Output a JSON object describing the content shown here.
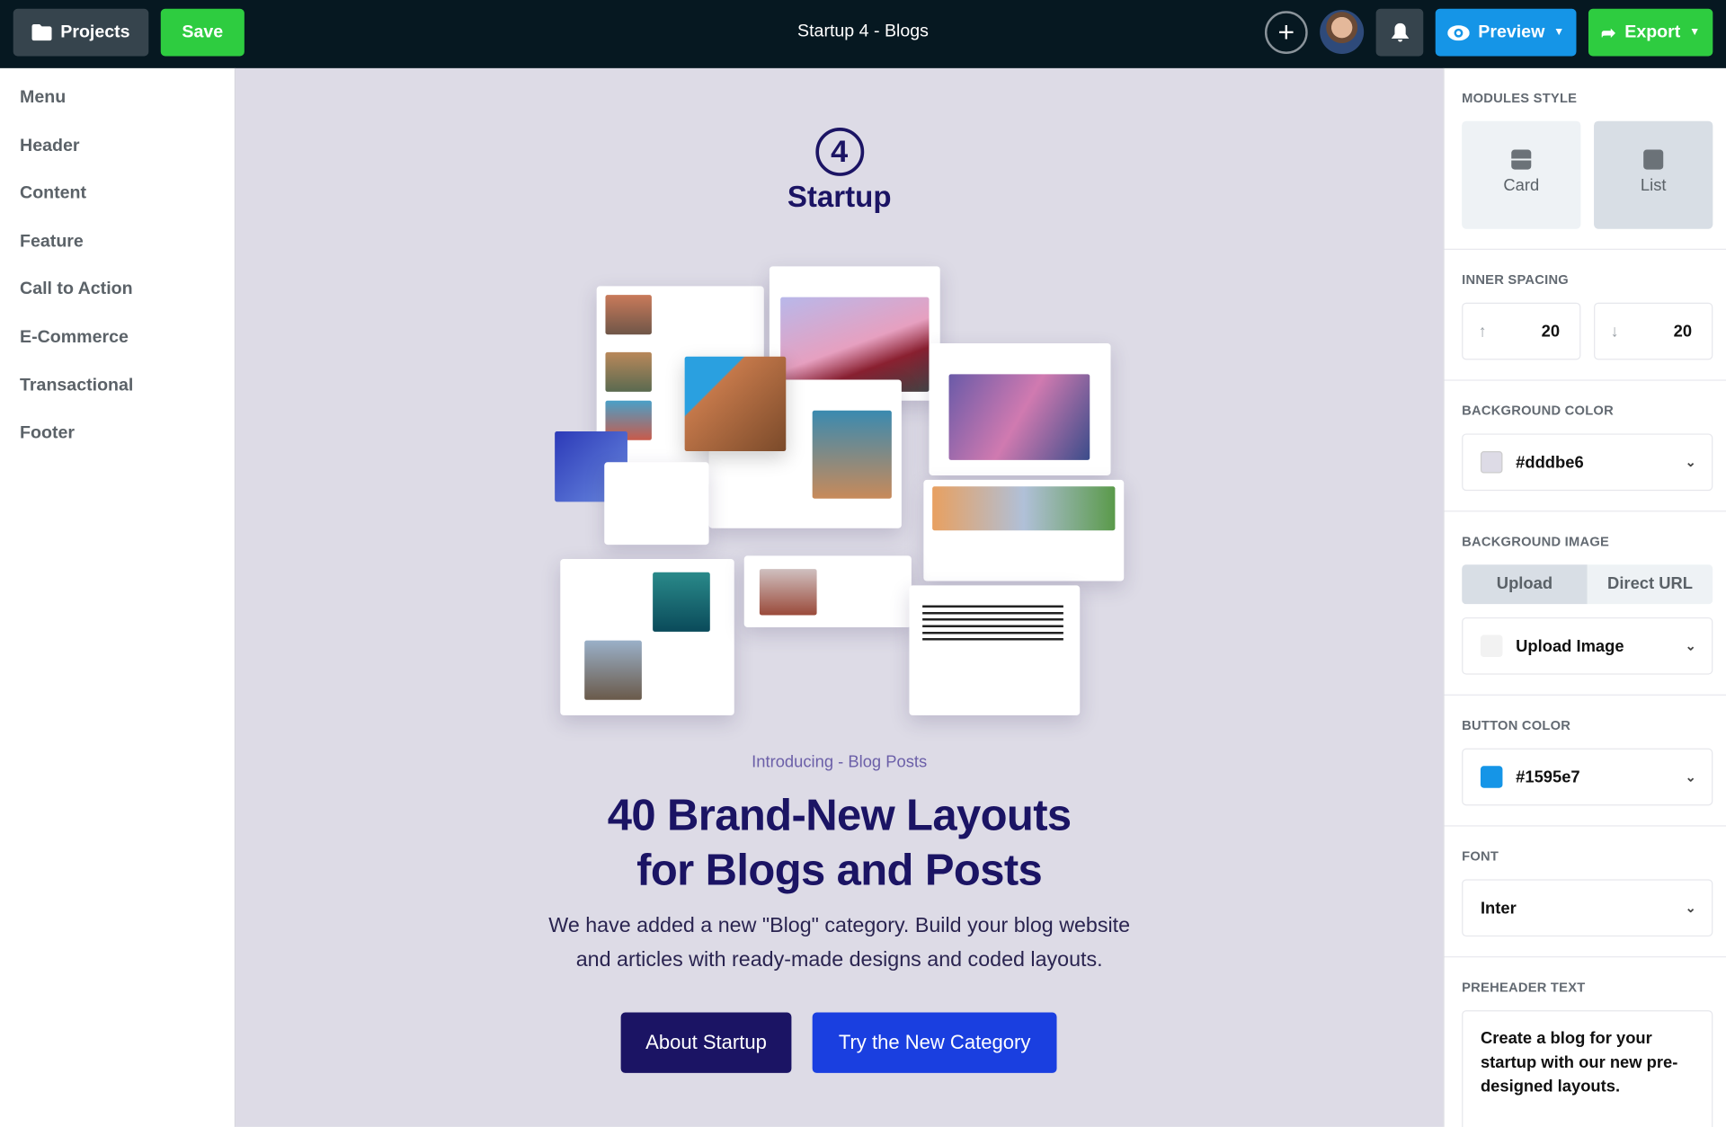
{
  "topbar": {
    "projects_label": "Projects",
    "save_label": "Save",
    "title": "Startup 4 - Blogs",
    "preview_label": "Preview",
    "export_label": "Export",
    "icons": {
      "projects": "folder-icon",
      "add": "plus-circle-icon",
      "notifications": "bell-icon",
      "preview": "eye-icon",
      "export": "share-arrow-icon"
    }
  },
  "sidebar": {
    "items": [
      {
        "label": "Menu"
      },
      {
        "label": "Header"
      },
      {
        "label": "Content"
      },
      {
        "label": "Feature"
      },
      {
        "label": "Call to Action"
      },
      {
        "label": "E-Commerce"
      },
      {
        "label": "Transactional"
      },
      {
        "label": "Footer"
      }
    ]
  },
  "canvas": {
    "background": "#dddbe6",
    "logo_number": "4",
    "logo_text": "Startup",
    "eyebrow": "Introducing - Blog Posts",
    "headline_line1": "40 Brand-New Layouts",
    "headline_line2": "for Blogs and Posts",
    "body_line1": "We have added a new \"Blog\" category. Build your blog website",
    "body_line2": "and articles with ready-made designs and coded layouts.",
    "primary_button": "About Startup",
    "secondary_button": "Try the New Category",
    "colors": {
      "dark": "#1b1464",
      "blue": "#1a3fe0"
    }
  },
  "panel": {
    "modules_style": {
      "label": "MODULES STYLE",
      "options": [
        {
          "label": "Card",
          "icon": "card-layout-icon"
        },
        {
          "label": "List",
          "icon": "list-layout-icon"
        }
      ],
      "selected": "List"
    },
    "inner_spacing": {
      "label": "INNER SPACING",
      "top": "20",
      "bottom": "20"
    },
    "background_color": {
      "label": "BACKGROUND COLOR",
      "value": "#dddbe6"
    },
    "background_image": {
      "label": "BACKGROUND IMAGE",
      "tabs": [
        "Upload",
        "Direct URL"
      ],
      "selected": "Upload",
      "value": "Upload Image"
    },
    "button_color": {
      "label": "BUTTON COLOR",
      "value": "#1595e7"
    },
    "font": {
      "label": "FONT",
      "value": "Inter"
    },
    "preheader": {
      "label": "PREHEADER TEXT",
      "value": "Create a blog for your startup with our new pre-designed layouts."
    }
  }
}
